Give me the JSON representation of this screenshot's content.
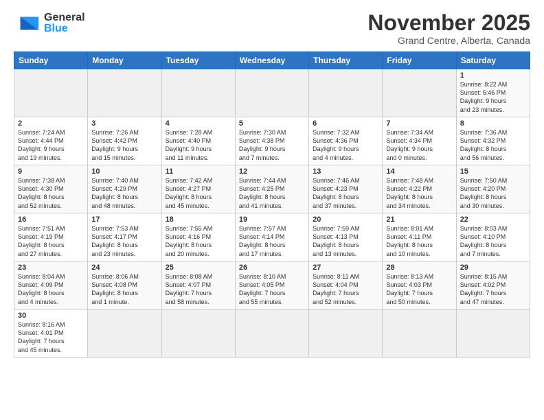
{
  "header": {
    "logo_word1": "General",
    "logo_word2": "Blue",
    "title": "November 2025",
    "subtitle": "Grand Centre, Alberta, Canada"
  },
  "days_of_week": [
    "Sunday",
    "Monday",
    "Tuesday",
    "Wednesday",
    "Thursday",
    "Friday",
    "Saturday"
  ],
  "weeks": [
    [
      {
        "day": "",
        "info": ""
      },
      {
        "day": "",
        "info": ""
      },
      {
        "day": "",
        "info": ""
      },
      {
        "day": "",
        "info": ""
      },
      {
        "day": "",
        "info": ""
      },
      {
        "day": "",
        "info": ""
      },
      {
        "day": "1",
        "info": "Sunrise: 8:22 AM\nSunset: 5:46 PM\nDaylight: 9 hours\nand 23 minutes."
      }
    ],
    [
      {
        "day": "2",
        "info": "Sunrise: 7:24 AM\nSunset: 4:44 PM\nDaylight: 9 hours\nand 19 minutes."
      },
      {
        "day": "3",
        "info": "Sunrise: 7:26 AM\nSunset: 4:42 PM\nDaylight: 9 hours\nand 15 minutes."
      },
      {
        "day": "4",
        "info": "Sunrise: 7:28 AM\nSunset: 4:40 PM\nDaylight: 9 hours\nand 11 minutes."
      },
      {
        "day": "5",
        "info": "Sunrise: 7:30 AM\nSunset: 4:38 PM\nDaylight: 9 hours\nand 7 minutes."
      },
      {
        "day": "6",
        "info": "Sunrise: 7:32 AM\nSunset: 4:36 PM\nDaylight: 9 hours\nand 4 minutes."
      },
      {
        "day": "7",
        "info": "Sunrise: 7:34 AM\nSunset: 4:34 PM\nDaylight: 9 hours\nand 0 minutes."
      },
      {
        "day": "8",
        "info": "Sunrise: 7:36 AM\nSunset: 4:32 PM\nDaylight: 8 hours\nand 56 minutes."
      }
    ],
    [
      {
        "day": "9",
        "info": "Sunrise: 7:38 AM\nSunset: 4:30 PM\nDaylight: 8 hours\nand 52 minutes."
      },
      {
        "day": "10",
        "info": "Sunrise: 7:40 AM\nSunset: 4:29 PM\nDaylight: 8 hours\nand 48 minutes."
      },
      {
        "day": "11",
        "info": "Sunrise: 7:42 AM\nSunset: 4:27 PM\nDaylight: 8 hours\nand 45 minutes."
      },
      {
        "day": "12",
        "info": "Sunrise: 7:44 AM\nSunset: 4:25 PM\nDaylight: 8 hours\nand 41 minutes."
      },
      {
        "day": "13",
        "info": "Sunrise: 7:46 AM\nSunset: 4:23 PM\nDaylight: 8 hours\nand 37 minutes."
      },
      {
        "day": "14",
        "info": "Sunrise: 7:48 AM\nSunset: 4:22 PM\nDaylight: 8 hours\nand 34 minutes."
      },
      {
        "day": "15",
        "info": "Sunrise: 7:50 AM\nSunset: 4:20 PM\nDaylight: 8 hours\nand 30 minutes."
      }
    ],
    [
      {
        "day": "16",
        "info": "Sunrise: 7:51 AM\nSunset: 4:19 PM\nDaylight: 8 hours\nand 27 minutes."
      },
      {
        "day": "17",
        "info": "Sunrise: 7:53 AM\nSunset: 4:17 PM\nDaylight: 8 hours\nand 23 minutes."
      },
      {
        "day": "18",
        "info": "Sunrise: 7:55 AM\nSunset: 4:16 PM\nDaylight: 8 hours\nand 20 minutes."
      },
      {
        "day": "19",
        "info": "Sunrise: 7:57 AM\nSunset: 4:14 PM\nDaylight: 8 hours\nand 17 minutes."
      },
      {
        "day": "20",
        "info": "Sunrise: 7:59 AM\nSunset: 4:13 PM\nDaylight: 8 hours\nand 13 minutes."
      },
      {
        "day": "21",
        "info": "Sunrise: 8:01 AM\nSunset: 4:11 PM\nDaylight: 8 hours\nand 10 minutes."
      },
      {
        "day": "22",
        "info": "Sunrise: 8:03 AM\nSunset: 4:10 PM\nDaylight: 8 hours\nand 7 minutes."
      }
    ],
    [
      {
        "day": "23",
        "info": "Sunrise: 8:04 AM\nSunset: 4:09 PM\nDaylight: 8 hours\nand 4 minutes."
      },
      {
        "day": "24",
        "info": "Sunrise: 8:06 AM\nSunset: 4:08 PM\nDaylight: 8 hours\nand 1 minute."
      },
      {
        "day": "25",
        "info": "Sunrise: 8:08 AM\nSunset: 4:07 PM\nDaylight: 7 hours\nand 58 minutes."
      },
      {
        "day": "26",
        "info": "Sunrise: 8:10 AM\nSunset: 4:05 PM\nDaylight: 7 hours\nand 55 minutes."
      },
      {
        "day": "27",
        "info": "Sunrise: 8:11 AM\nSunset: 4:04 PM\nDaylight: 7 hours\nand 52 minutes."
      },
      {
        "day": "28",
        "info": "Sunrise: 8:13 AM\nSunset: 4:03 PM\nDaylight: 7 hours\nand 50 minutes."
      },
      {
        "day": "29",
        "info": "Sunrise: 8:15 AM\nSunset: 4:02 PM\nDaylight: 7 hours\nand 47 minutes."
      }
    ],
    [
      {
        "day": "30",
        "info": "Sunrise: 8:16 AM\nSunset: 4:01 PM\nDaylight: 7 hours\nand 45 minutes."
      },
      {
        "day": "",
        "info": ""
      },
      {
        "day": "",
        "info": ""
      },
      {
        "day": "",
        "info": ""
      },
      {
        "day": "",
        "info": ""
      },
      {
        "day": "",
        "info": ""
      },
      {
        "day": "",
        "info": ""
      }
    ]
  ]
}
